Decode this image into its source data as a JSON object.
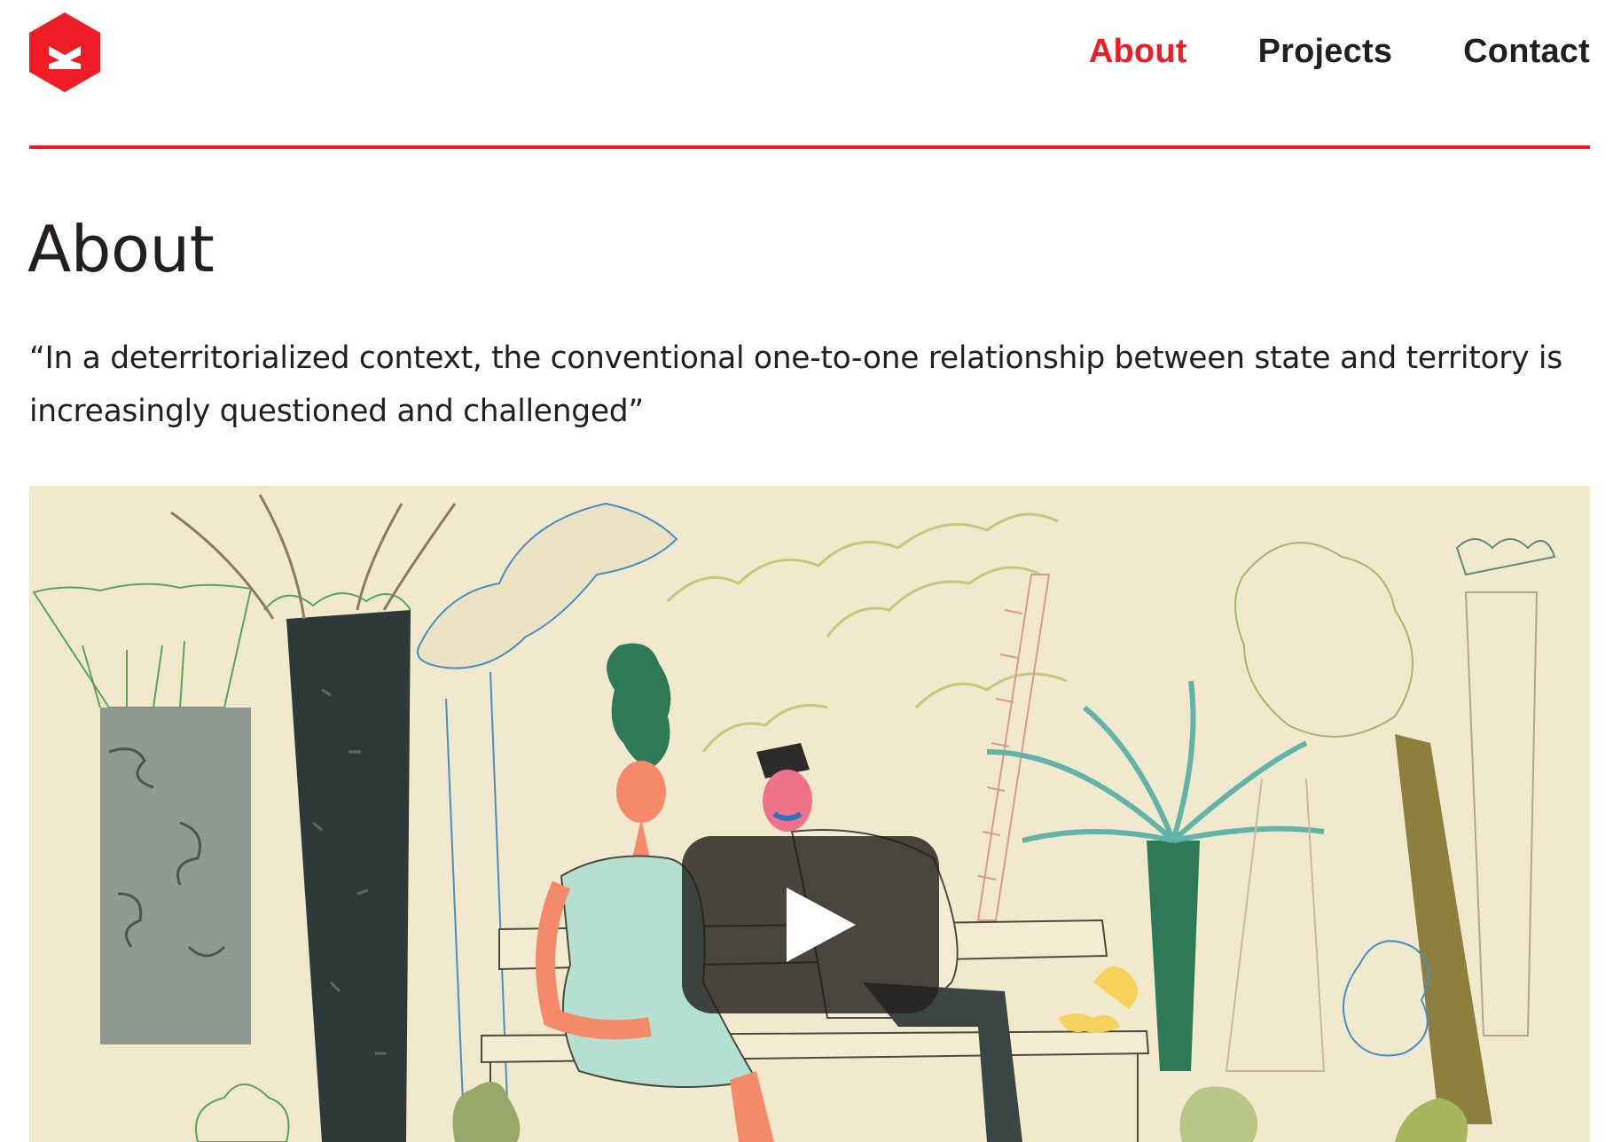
{
  "header": {
    "logo_icon": "hexagon-logo-icon",
    "brand_color": "#ee1c25",
    "nav": [
      {
        "label": "About",
        "active": true
      },
      {
        "label": "Projects",
        "active": false
      },
      {
        "label": "Contact",
        "active": false
      }
    ]
  },
  "main": {
    "title": "About",
    "quote": "“In a deterritorialized context, the conventional one-to-one relationship between state and territory is increasingly questioned and challenged”",
    "video": {
      "play_icon": "play-icon",
      "background_color": "#f1e9cd"
    }
  }
}
